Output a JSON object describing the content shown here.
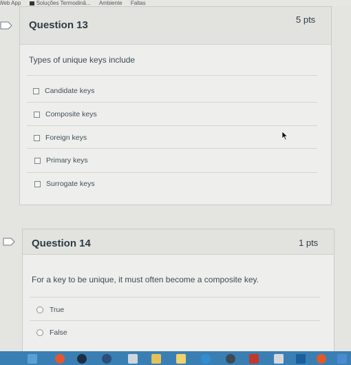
{
  "bookmarks": [
    "Web App",
    "Soluções Termodinâ...",
    "Ambiente",
    "Faltas"
  ],
  "questions": [
    {
      "title": "Question 13",
      "points": "5 pts",
      "text": "Types of unique keys include",
      "answers": [
        "Candidate keys",
        "Composite keys",
        "Foreign keys",
        "Primary keys",
        "Surrogate keys"
      ]
    },
    {
      "title": "Question 14",
      "points": "1 pts",
      "text": "For a key to be unique, it must often become a composite key.",
      "answers": [
        "True",
        "False"
      ]
    }
  ],
  "colors": {
    "taskbar": "#3a7fb3",
    "page": "#e4e5e1",
    "card": "#eeefec",
    "text": "#2d3b45"
  },
  "icons": [
    "flag-icon",
    "mouse-pointer-icon",
    "checkbox-icon",
    "radio-icon"
  ]
}
